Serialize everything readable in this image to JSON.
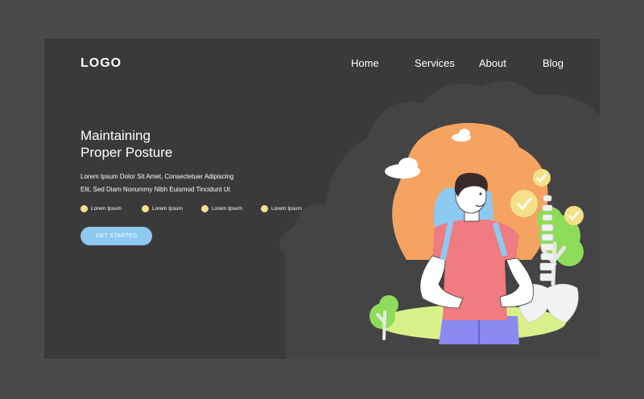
{
  "header": {
    "logo": "LOGO",
    "nav": [
      "Home",
      "Services",
      "About",
      "Blog"
    ]
  },
  "hero": {
    "title_line1": "Maintaining",
    "title_line2": "Proper Posture",
    "body_line1": "Lorem Ipsum Dolor Sit Amet, Consectetuer Adipiscing",
    "body_line2": "Elit, Sed Diam Nonummy Nibh Euismod Tincidunt Ut",
    "bullets": [
      "Lorem Ipsum",
      "Lorem Ipsum",
      "Lorem Ipsum",
      "Lorem Ipsum"
    ],
    "cta_label": "GET STARTED"
  },
  "colors": {
    "outer_bg": "#4a4a4a",
    "page_bg": "#3a3a3a",
    "accent_blue": "#8ec9f2",
    "bullet_yellow": "#f5e08a",
    "shirt_pink": "#f07b80",
    "sun_orange": "#f4a460",
    "grass_green": "#d7f08a"
  },
  "icons": [
    "check-badge-icon",
    "cloud-icon",
    "tree-icon",
    "spine-icon",
    "backpack-icon"
  ]
}
